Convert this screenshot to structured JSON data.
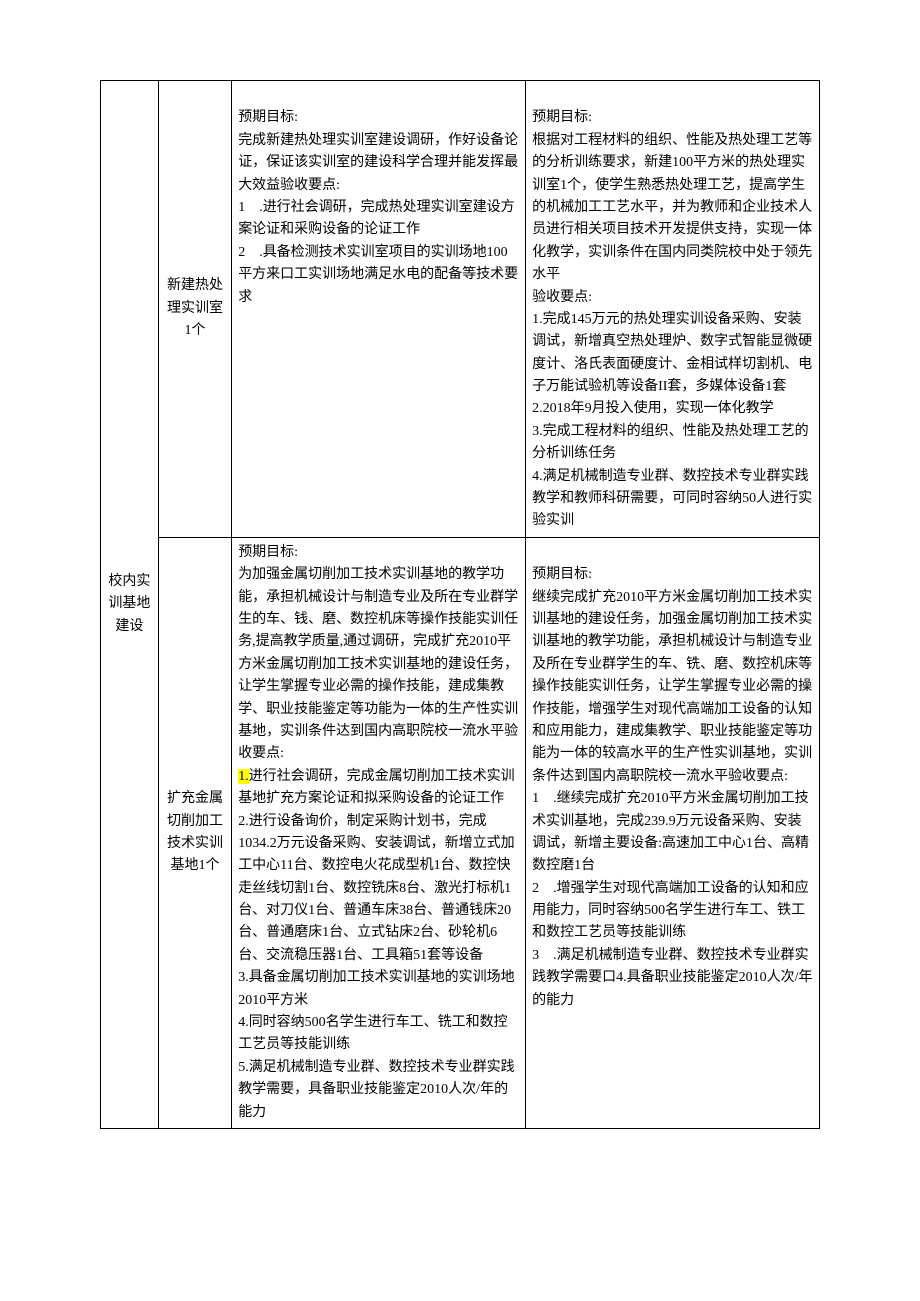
{
  "table": {
    "col1": "校内实训基地建设",
    "rows": [
      {
        "col2": "新建热处理实训室1个",
        "col3": "预期目标:\n完成新建热处理实训室建设调研，作好设备论证，保证该实训室的建设科学合理并能发挥最大效益验收要点:\n1 .进行社会调研，完成热处理实训室建设方案论证和采购设备的论证工作\n2 .具备检测技术实训室项目的实训场地100平方来口工实训场地满足水电的配备等技术要求",
        "col4": "预期目标:\n根据对工程材料的组织、性能及热处理工艺等的分析训练要求，新建100平方米的热处理实训室1个，使学生熟悉热处理工艺，提高学生的机械加工工艺水平，并为教师和企业技术人员进行相关项目技术开发提供支持，实现一体化教学，实训条件在国内同类院校中处于领先水平\n验收要点:\n1.完成145万元的热处理实训设备采购、安装调试，新增真空热处理炉、数字式智能显微硬度计、洛氏表面硬度计、金相试样切割机、电子万能试验机等设备II套，多媒体设备1套\n2.2018年9月投入使用，实现一体化教学\n3.完成工程材料的组织、性能及热处理工艺的分析训练任务\n4.满足机械制造专业群、数控技术专业群实践教学和教师科研需要，可同时容纳50人进行实验实训"
      },
      {
        "col2": "扩充金属切削加工技术实训基地1个",
        "col3_top": "预期目标:\n为加强金属切削加工技术实训基地的教学功能，承担机械设计与制造专业及所在专业群学生的车、钱、磨、数控机床等操作技能实训任务,提高教学质量,通过调研，完成扩充2010平方米金属切削加工技术实训基地的建设任务，让学生掌握专业必需的操作技能，建成集教学、职业技能鉴定等功能为一体的生产性实训基地，实训条件达到国内高职院校一流水平验收要点:",
        "col3_highlight": "1.",
        "col3_after_highlight": "进行社会调研，完成金属切削加工技术实训基地扩充方案论证和拟采购设备的论证工作",
        "col3_rest": "2.进行设备询价，制定采购计划书，完成1034.2万元设备采购、安装调试，新增立式加工中心11台、数控电火花成型机1台、数控快走丝线切割1台、数控铣床8台、激光打标机1台、对刀仪1台、普通车床38台、普通钱床20台、普通磨床1台、立式钻床2台、砂轮机6台、交流稳压器1台、工具箱51套等设备\n3.具备金属切削加工技术实训基地的实训场地2010平方米\n4.同时容纳500名学生进行车工、铣工和数控工艺员等技能训练\n5.满足机械制造专业群、数控技术专业群实践教学需要，具备职业技能鉴定2010人次/年的能力",
        "col4": "预期目标:\n继续完成扩充2010平方米金属切削加工技术实训基地的建设任务，加强金属切削加工技术实训基地的教学功能，承担机械设计与制造专业及所在专业群学生的车、铣、磨、数控机床等操作技能实训任务，让学生掌握专业必需的操作技能，增强学生对现代高端加工设备的认知和应用能力，建成集教学、职业技能鉴定等功能为一体的较高水平的生产性实训基地，实训条件达到国内高职院校一流水平验收要点:\n1 .继续完成扩充2010平方米金属切削加工技术实训基地，完成239.9万元设备采购、安装调试，新增主要设备:高速加工中心1台、高精数控磨1台\n2 .增强学生对现代高端加工设备的认知和应用能力，同时容纳500名学生进行车工、铁工和数控工艺员等技能训练\n3 .满足机械制造专业群、数控技术专业群实践教学需要口4.具备职业技能鉴定2010人次/年的能力"
      }
    ]
  }
}
